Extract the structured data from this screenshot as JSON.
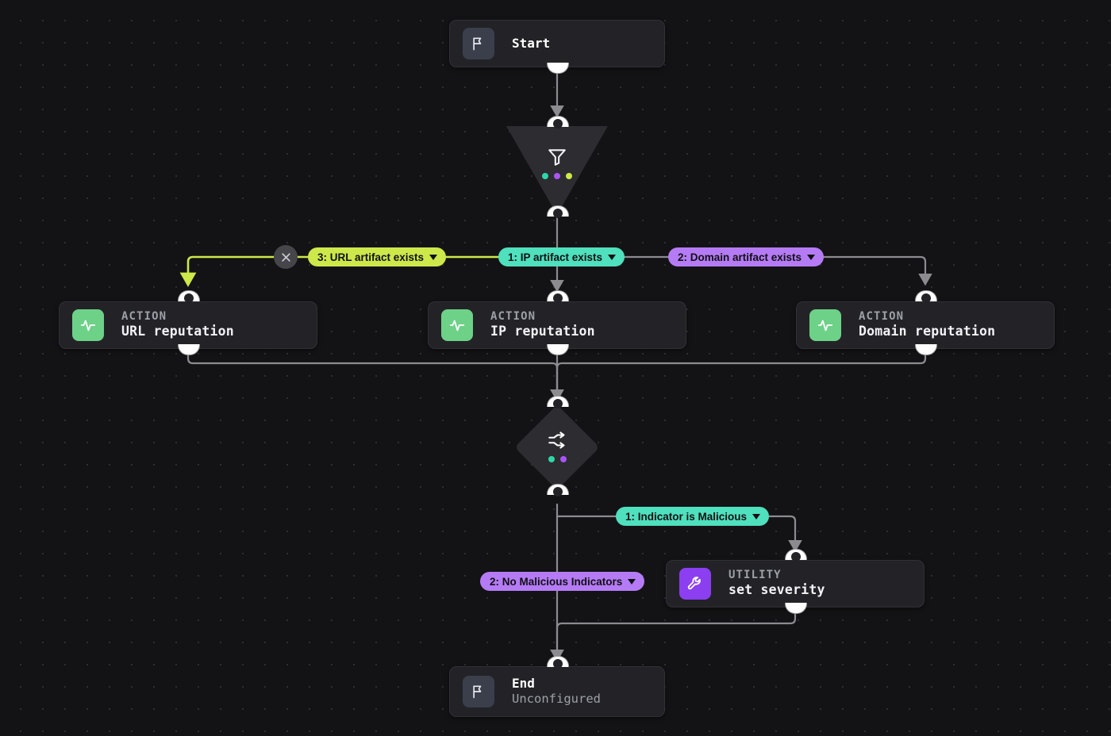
{
  "canvas": {
    "background_color": "#131315",
    "grid_dot_color": "#2e2e33"
  },
  "nodes": [
    {
      "id": "start",
      "type": "terminal",
      "icon": "flag-icon",
      "title": "Start",
      "subtitle": ""
    },
    {
      "id": "filter",
      "type": "filter",
      "icon": "funnel-icon",
      "dot_colors": [
        "#2fd6a8",
        "#a855f7",
        "#cde84a"
      ]
    },
    {
      "id": "url_reputation",
      "type": "action",
      "kind": "ACTION",
      "icon": "activity-pulse-icon",
      "title": "URL reputation",
      "icon_color": "#6ed188"
    },
    {
      "id": "ip_reputation",
      "type": "action",
      "kind": "ACTION",
      "icon": "activity-pulse-icon",
      "title": "IP reputation",
      "icon_color": "#6ed188"
    },
    {
      "id": "domain_reputation",
      "type": "action",
      "kind": "ACTION",
      "icon": "activity-pulse-icon",
      "title": "Domain reputation",
      "icon_color": "#6ed188"
    },
    {
      "id": "decision",
      "type": "decision",
      "icon": "branch-arrows-icon",
      "dot_colors": [
        "#2fd6a8",
        "#a855f7"
      ]
    },
    {
      "id": "set_severity",
      "type": "utility",
      "kind": "UTILITY",
      "icon": "wrench-icon",
      "title": "set severity",
      "icon_color": "#8b3ff0"
    },
    {
      "id": "end",
      "type": "terminal",
      "icon": "flag-icon",
      "title": "End",
      "subtitle": "Unconfigured"
    }
  ],
  "edge_labels": [
    {
      "id": "url_branch",
      "text": "3: URL artifact exists",
      "color": "#cde84a",
      "caret": "chevron-down-icon"
    },
    {
      "id": "ip_branch",
      "text": "1: IP artifact exists",
      "color": "#4fe0bd",
      "caret": "chevron-down-icon"
    },
    {
      "id": "domain_branch",
      "text": "2: Domain artifact exists",
      "color": "#b57bf5",
      "caret": "chevron-down-icon"
    },
    {
      "id": "malicious",
      "text": "1: Indicator is Malicious",
      "color": "#4fe0bd",
      "caret": "chevron-down-icon"
    },
    {
      "id": "no_malicious",
      "text": "2: No Malicious Indicators",
      "color": "#b57bf5",
      "caret": "chevron-down-icon"
    }
  ],
  "controls": {
    "delete_edge": {
      "icon": "close-x-icon",
      "label": ""
    }
  },
  "selection": {
    "selected_edge": "url_branch",
    "highlight_color": "#cde84a"
  },
  "labels": {
    "action_kind": "ACTION",
    "utility_kind": "UTILITY"
  }
}
